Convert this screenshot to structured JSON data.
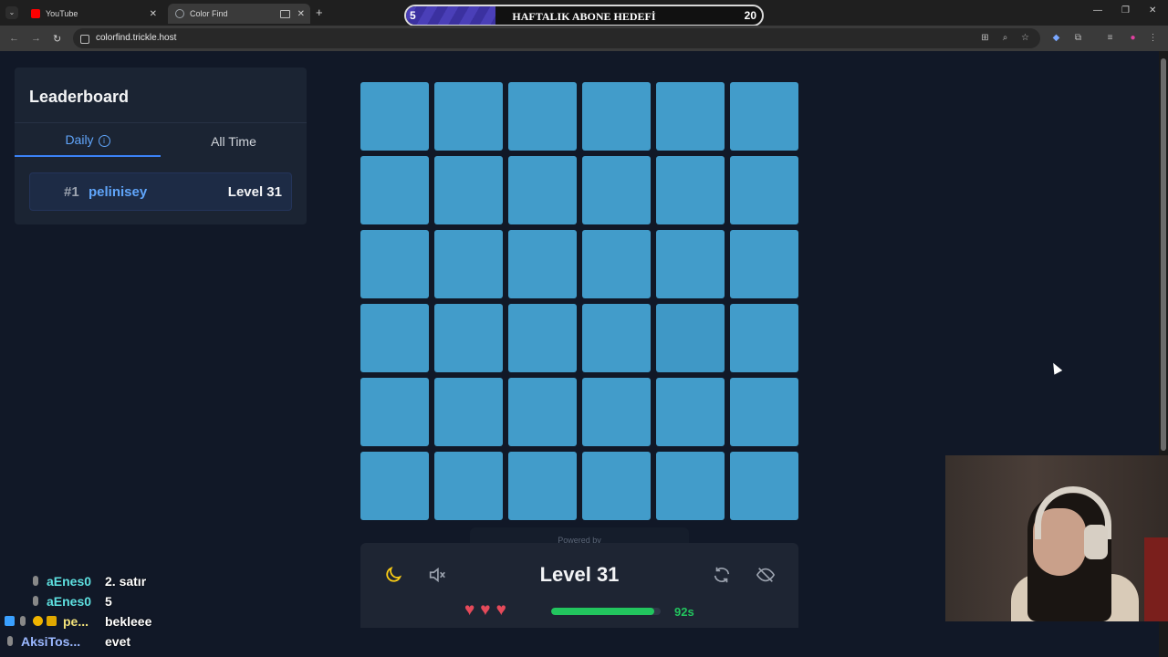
{
  "browser": {
    "tabs": [
      {
        "title": "YouTube",
        "favicon_color": "#ff0000"
      },
      {
        "title": "Color Find",
        "favicon_color": "#9aa0a6"
      }
    ],
    "url": "colorfind.trickle.host",
    "new_tab_symbol": "+",
    "tab_close_symbol": "✕",
    "window_controls": {
      "minimize": "—",
      "restore": "❐",
      "close": "✕"
    }
  },
  "stream_goal": {
    "start": "5",
    "title": "HAFTALIK ABONE HEDEFİ",
    "end": "20",
    "fill_color": "#4a3fb8"
  },
  "leaderboard": {
    "title": "Leaderboard",
    "tabs": {
      "daily": "Daily",
      "all_time": "All Time"
    },
    "info_symbol": "i",
    "entries": [
      {
        "rank": "#1",
        "name": "pelinisey",
        "level": "Level 31"
      }
    ]
  },
  "game": {
    "grid_rows": 6,
    "grid_cols": 6,
    "tile_color": "#429cca",
    "odd_tile_color": "#3f98c6",
    "odd_tile_index": 22,
    "powered_by": "Powered by",
    "level_label": "Level 31",
    "lives": 3,
    "heart_symbol": "♥",
    "time_remaining_fraction": 0.94,
    "seconds_label": "92s",
    "controls": [
      "moon-icon",
      "mute-icon",
      "restart-icon",
      "hide-icon"
    ]
  },
  "chat": [
    {
      "user": "aEnes0",
      "user_color": "#5ee0e0",
      "text": "2. satır",
      "badges": [
        "wrench-badge"
      ]
    },
    {
      "user": "aEnes0",
      "user_color": "#5ee0e0",
      "text": "5",
      "badges": [
        "wrench-badge"
      ]
    },
    {
      "user": "pe...",
      "user_color": "#f3e27a",
      "text": "bekleee",
      "badges": [
        "cube-badge",
        "wrench-badge",
        "warning-badge",
        "crown-badge"
      ]
    },
    {
      "user": "AksiTos...",
      "user_color": "#9bb8ff",
      "text": "evet",
      "badges": [
        "wrench-badge"
      ]
    }
  ]
}
